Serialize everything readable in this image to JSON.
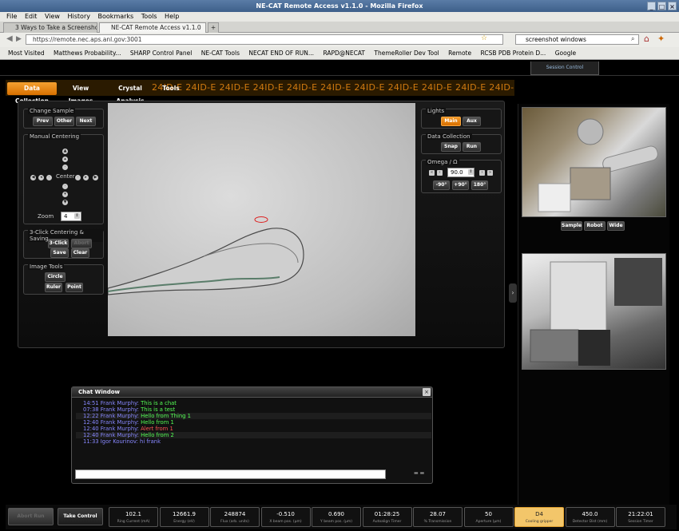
{
  "window": {
    "title": "NE-CAT Remote Access v1.1.0 - Mozilla Firefox"
  },
  "menu": [
    "File",
    "Edit",
    "View",
    "History",
    "Bookmarks",
    "Tools",
    "Help"
  ],
  "tabs": [
    {
      "label": "3 Ways to Take a Screenshot..."
    },
    {
      "label": "NE-CAT Remote Access v1.1.0"
    }
  ],
  "url": "https://remote.nec.aps.anl.gov:3001",
  "search": {
    "value": "screenshot windows"
  },
  "bookmarks": [
    "Most Visited",
    "Matthews Probability...",
    "SHARP Control Panel",
    "NE-CAT Tools",
    "NECAT END OF RUN...",
    "RAPD@NECAT",
    "ThemeRoller Dev Tool",
    "Remote",
    "RCSB PDB Protein D...",
    "Google"
  ],
  "session_control": "Session Control",
  "ticker_text": "24ID-E 24ID-E 24ID-E 24ID-E 24ID-E 24ID-E 24ID-E 24ID-E 24ID-E 24ID-E 24ID-E",
  "nav": [
    "Data Collection",
    "View Images",
    "Crystal Analysis",
    "Tools"
  ],
  "left": {
    "change_sample": {
      "title": "Change Sample",
      "buttons": [
        "Prev",
        "Other",
        "Next"
      ]
    },
    "manual_centering": {
      "title": "Manual Centering",
      "center_label": "Center",
      "zoom_label": "Zoom",
      "zoom_value": "4"
    },
    "three_click": {
      "title": "3-Click Centering & Saving",
      "buttons": [
        "3-Click",
        "Abort",
        "Save",
        "Clear"
      ]
    },
    "image_tools": {
      "title": "Image Tools",
      "buttons": [
        "Circle",
        "Ruler",
        "Point"
      ]
    }
  },
  "right": {
    "lights": {
      "title": "Lights",
      "buttons": [
        "Main",
        "Aux"
      ]
    },
    "data_collection": {
      "title": "Data Collection",
      "buttons": [
        "Snap",
        "Run"
      ]
    },
    "omega": {
      "title": "Omega / Ω",
      "value": "90.0",
      "buttons": [
        "-90°",
        "+90°",
        "180°"
      ]
    }
  },
  "camera_tabs": [
    "Sample",
    "Robot",
    "Wide"
  ],
  "chat": {
    "title": "Chat Window",
    "messages": [
      {
        "time": "14:51",
        "user": "Frank Murphy:",
        "text": "This is a chat",
        "color": "#5f5"
      },
      {
        "time": "07:38",
        "user": "Frank Murphy:",
        "text": "This is a test",
        "color": "#5f5"
      },
      {
        "time": "12:22",
        "user": "Frank Murphy:",
        "text": "Hello from Thing 1",
        "color": "#5f5"
      },
      {
        "time": "12:40",
        "user": "Frank Murphy:",
        "text": "Hello from 1",
        "color": "#5f5"
      },
      {
        "time": "12:40",
        "user": "Frank Murphy:",
        "text": "Alert from 1",
        "color": "#f55"
      },
      {
        "time": "12:40",
        "user": "Frank Murphy:",
        "text": "Hello from 2",
        "color": "#5f5"
      },
      {
        "time": "11:33",
        "user": "Igor Kourinov:",
        "text": "hi frank",
        "color": "#88f"
      }
    ]
  },
  "bottom": {
    "abort_run": "Abort Run",
    "take_control": "Take Control",
    "stats": [
      {
        "value": "102.1",
        "label": "Ring Current (mA)"
      },
      {
        "value": "12661.9",
        "label": "Energy (eV)"
      },
      {
        "value": "248874",
        "label": "Flux (arb. units)"
      },
      {
        "value": "-0.510",
        "label": "X beam pos. (μm)"
      },
      {
        "value": "0.690",
        "label": "Y beam pos. (μm)"
      },
      {
        "value": "01:28:25",
        "label": "Autoalign Timer"
      },
      {
        "value": "28.07",
        "label": "% Transmission"
      },
      {
        "value": "50",
        "label": "Aperture (μm)"
      },
      {
        "value": "D4",
        "label": "Cooling gripper"
      },
      {
        "value": "450.0",
        "label": "Detector Dist (mm)"
      },
      {
        "value": "21:22:01",
        "label": "Session Timer"
      }
    ]
  }
}
